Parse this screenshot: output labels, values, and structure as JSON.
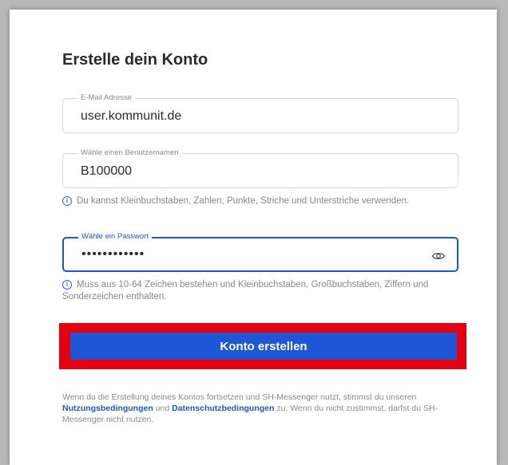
{
  "page": {
    "title": "Erstelle dein Konto"
  },
  "email": {
    "label": "E-Mail Adresse",
    "value": "user.kommunit.de"
  },
  "username": {
    "label": "Wähle einen Benutzernamen",
    "value": "B100000",
    "hint": "Du kannst Kleinbuchstaben, Zahlen, Punkte, Striche und Unterstriche verwenden."
  },
  "password": {
    "label": "Wähle ein Passwort",
    "masked_value": "••••••••••••",
    "hint": "Muss aus 10-64 Zeichen bestehen und Kleinbuchstaben, Großbuchstaben, Ziffern und Sonderzeichen enthalten.",
    "toggle_icon": "eye-icon"
  },
  "info_icon_glyph": "i",
  "submit": {
    "label": "Konto erstellen"
  },
  "legal": {
    "part1": "Wenn du die Erstellung deines Kontos fortsetzen und SH-Messenger nutzt, stimmst du unseren ",
    "terms_link": "Nutzungsbedingungen",
    "part2": " und ",
    "privacy_link": "Datenschutzbedingungen",
    "part3": " zu. Wenn du nicht zustimmst, darfst du SH-Messenger nicht nutzen."
  },
  "colors": {
    "accent": "#1f56d6",
    "highlight_border": "#e4000f",
    "text": "#2b2b2b",
    "muted": "#888888"
  }
}
